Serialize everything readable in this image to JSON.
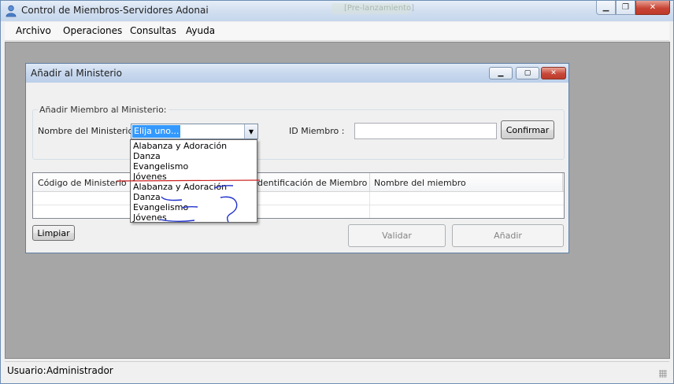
{
  "main_window": {
    "title": "Control de Miembros-Servidores Adonai",
    "ghost_tab": "[Pre-lanzamiento]"
  },
  "menu": [
    "Archivo",
    "Operaciones",
    "Consultas",
    "Ayuda"
  ],
  "child_window": {
    "title": "Añadir al Ministerio",
    "group_label": "Añadir Miembro al Ministerio:",
    "ministry_label": "Nombre del Ministerio :",
    "combo_selected": "Elija uno...",
    "id_label": "ID Miembro :",
    "id_value": "",
    "confirm_button": "Confirmar",
    "grid_headers": [
      "Código de  Ministerio",
      "dentificación de Miembro",
      "Nombre del miembro"
    ],
    "limpiar_button": "Limpiar",
    "validar_button": "Validar",
    "anadir_button": "Añadir"
  },
  "dropdown_items": [
    "Alabanza y Adoración",
    "Danza",
    "Evangelismo",
    "Jóvenes",
    "Alabanza y Adoración",
    "Danza",
    "Evangelismo",
    "Jóvenes"
  ],
  "status_bar": {
    "label": "Usuario:",
    "value": "Administrador"
  },
  "colors": {
    "mdi_background": "#a6a6a6",
    "selection": "#3399ff",
    "annotation_red": "#cc2222",
    "annotation_blue": "#2233cc"
  }
}
